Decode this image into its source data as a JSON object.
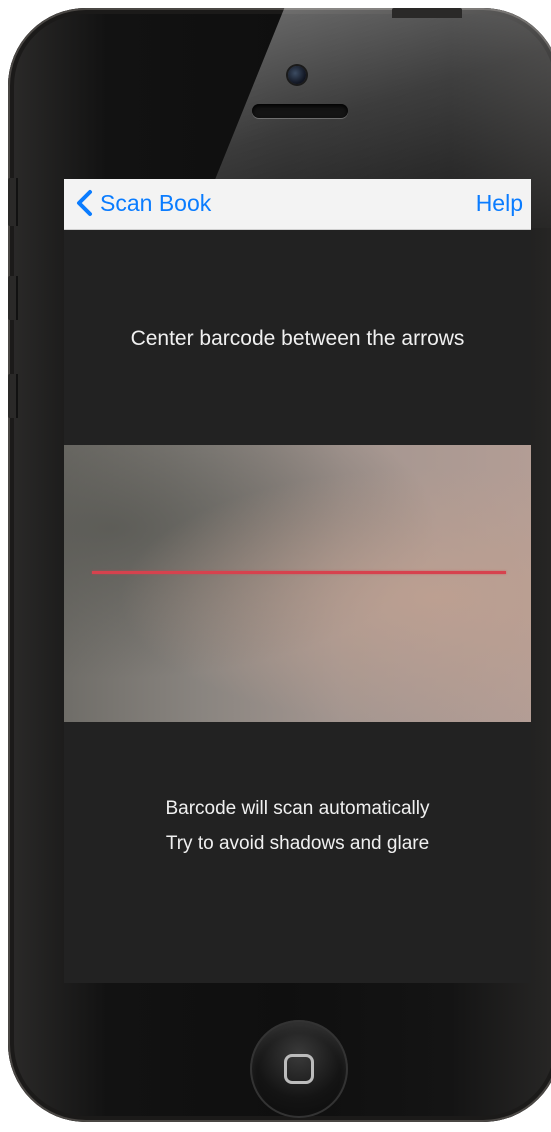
{
  "nav": {
    "back_label": "Scan Book",
    "help_label": "Help"
  },
  "scanner": {
    "instruction": "Center barcode between the arrows",
    "hint_line_1": "Barcode will scan automatically",
    "hint_line_2": "Try to avoid shadows and glare"
  },
  "colors": {
    "accent": "#0a7cff",
    "scan_line": "#d6424e",
    "panel": "#222222",
    "nav_background": "#f3f3f3"
  },
  "icons": {
    "back": "chevron-left-icon",
    "home": "home-square-icon"
  }
}
